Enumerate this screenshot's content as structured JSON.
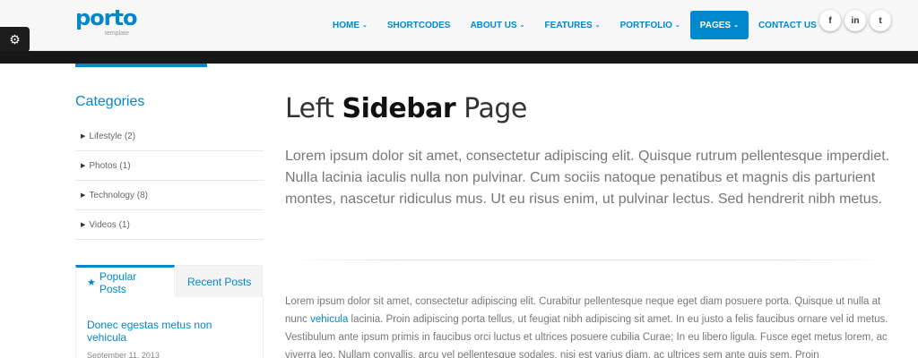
{
  "logo": {
    "word": "porto",
    "sub": "template"
  },
  "nav": {
    "items": [
      {
        "label": "HOME",
        "caret": "⌄"
      },
      {
        "label": "SHORTCODES",
        "caret": ""
      },
      {
        "label": "ABOUT US",
        "caret": "⌄"
      },
      {
        "label": "FEATURES",
        "caret": "⌄"
      },
      {
        "label": "PORTFOLIO",
        "caret": "⌄"
      },
      {
        "label": "PAGES",
        "caret": "⌄",
        "active": true
      },
      {
        "label": "CONTACT US",
        "caret": "⌄"
      }
    ]
  },
  "social": [
    {
      "icon": "facebook-icon",
      "glyph": "f"
    },
    {
      "icon": "linkedin-icon",
      "glyph": "in"
    },
    {
      "icon": "twitter-icon",
      "glyph": "t"
    }
  ],
  "sidebar": {
    "categories_title": "Categories",
    "categories": [
      {
        "label": "Lifestyle (2)"
      },
      {
        "label": "Photos (1)"
      },
      {
        "label": "Technology (8)"
      },
      {
        "label": "Videos (1)"
      }
    ],
    "tabs": {
      "popular": "Popular Posts",
      "recent": "Recent Posts"
    },
    "post": {
      "title": "Donec egestas metus non vehicula",
      "date": "September 11, 2013"
    }
  },
  "main": {
    "title_pre": "Left ",
    "title_bold": "Sidebar",
    "title_post": " Page",
    "lead": "Lorem ipsum dolor sit amet, consectetur adipiscing elit. Quisque rutrum pellentesque imperdiet. Nulla lacinia iaculis nulla non pulvinar. Cum sociis natoque penatibus et magnis dis parturient montes, nascetur ridiculus mus. Ut eu risus enim, ut pulvinar lectus. Sed hendrerit nibh metus.",
    "body_1": "Lorem ipsum dolor sit amet, consectetur adipiscing elit. Curabitur pellentesque neque eget diam posuere porta. Quisque ut nulla at nunc ",
    "body_link": "vehicula",
    "body_2": " lacinia. Proin adipiscing porta tellus, ut feugiat nibh adipiscing sit amet. In eu justo a felis faucibus ornare vel id metus. Vestibulum ante ipsum primis in faucibus orci luctus et ultrices posuere cubilia Curae; In eu libero ligula. Fusce eget metus lorem, ac viverra leo. Nullam convallis, arcu vel pellentesque sodales, nisi est varius diam, ac ultrices sem ante quis sem. Proin"
  },
  "colors": {
    "accent": "#0088cc",
    "dark_bar": "#171717"
  }
}
